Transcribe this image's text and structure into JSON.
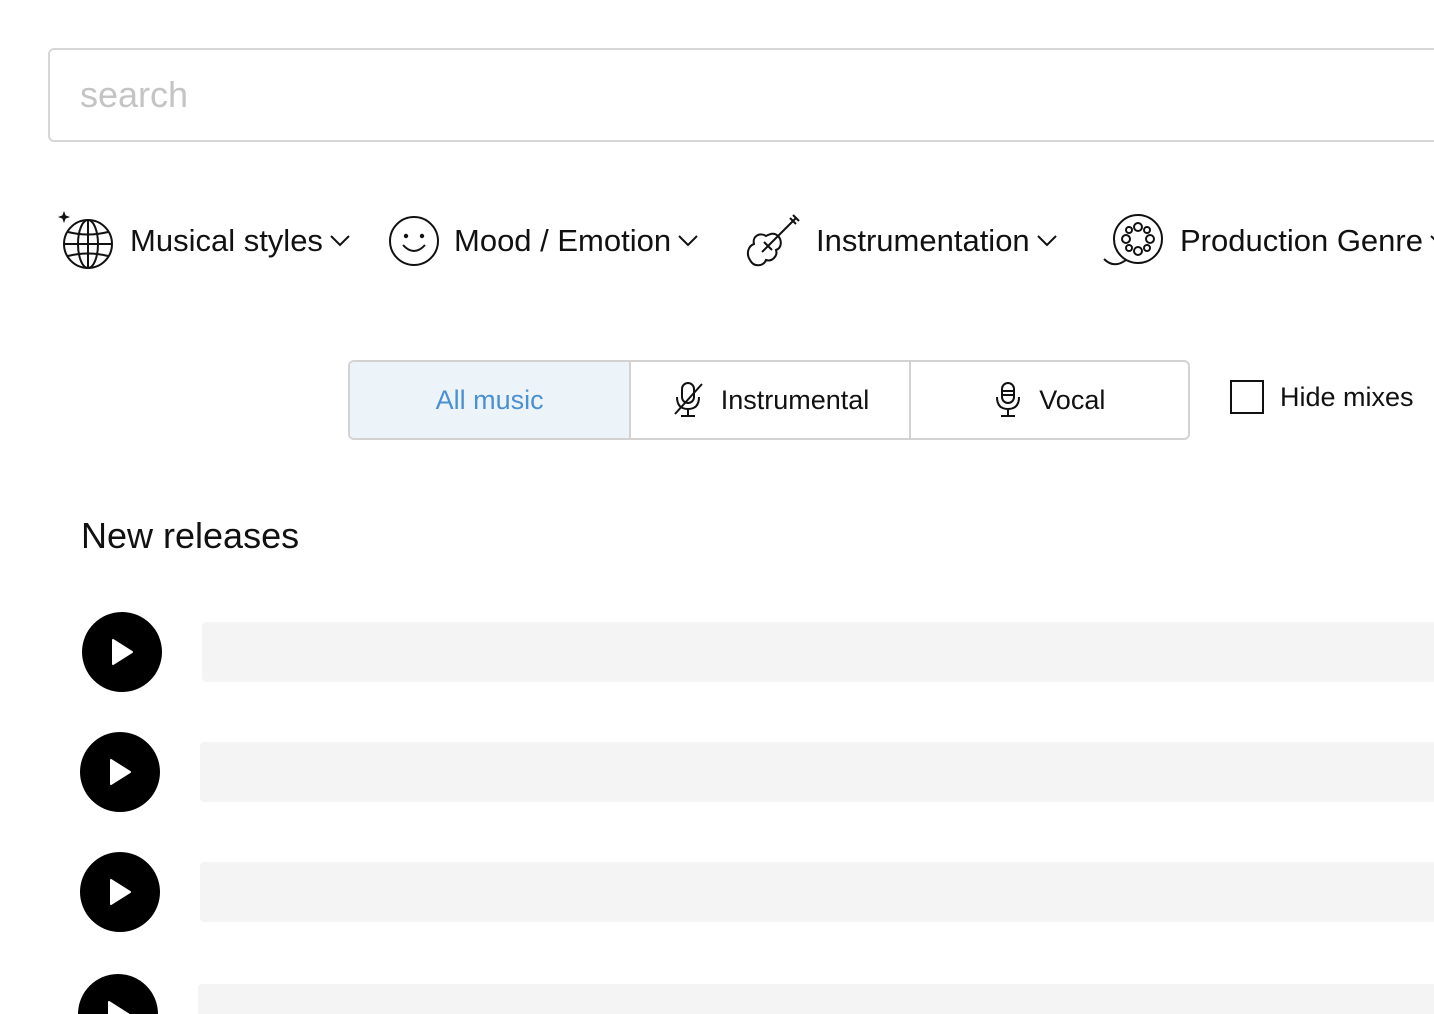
{
  "search": {
    "placeholder": "search",
    "value": ""
  },
  "filters": [
    {
      "label": "Musical styles",
      "icon": "globe-sparkle-icon"
    },
    {
      "label": "Mood / Emotion",
      "icon": "smiley-icon"
    },
    {
      "label": "Instrumentation",
      "icon": "violin-icon"
    },
    {
      "label": "Production Genre",
      "icon": "film-reel-icon"
    }
  ],
  "vocal_toggle": {
    "options": [
      {
        "label": "All music",
        "active": true
      },
      {
        "label": "Instrumental",
        "icon": "microphone-off-icon",
        "active": false
      },
      {
        "label": "Vocal",
        "icon": "microphone-icon",
        "active": false
      }
    ],
    "active_color": "#4a90d2",
    "active_bg": "#edf4f9"
  },
  "hide_mixes": {
    "label": "Hide mixes",
    "checked": false
  },
  "new_releases": {
    "title": "New releases"
  }
}
